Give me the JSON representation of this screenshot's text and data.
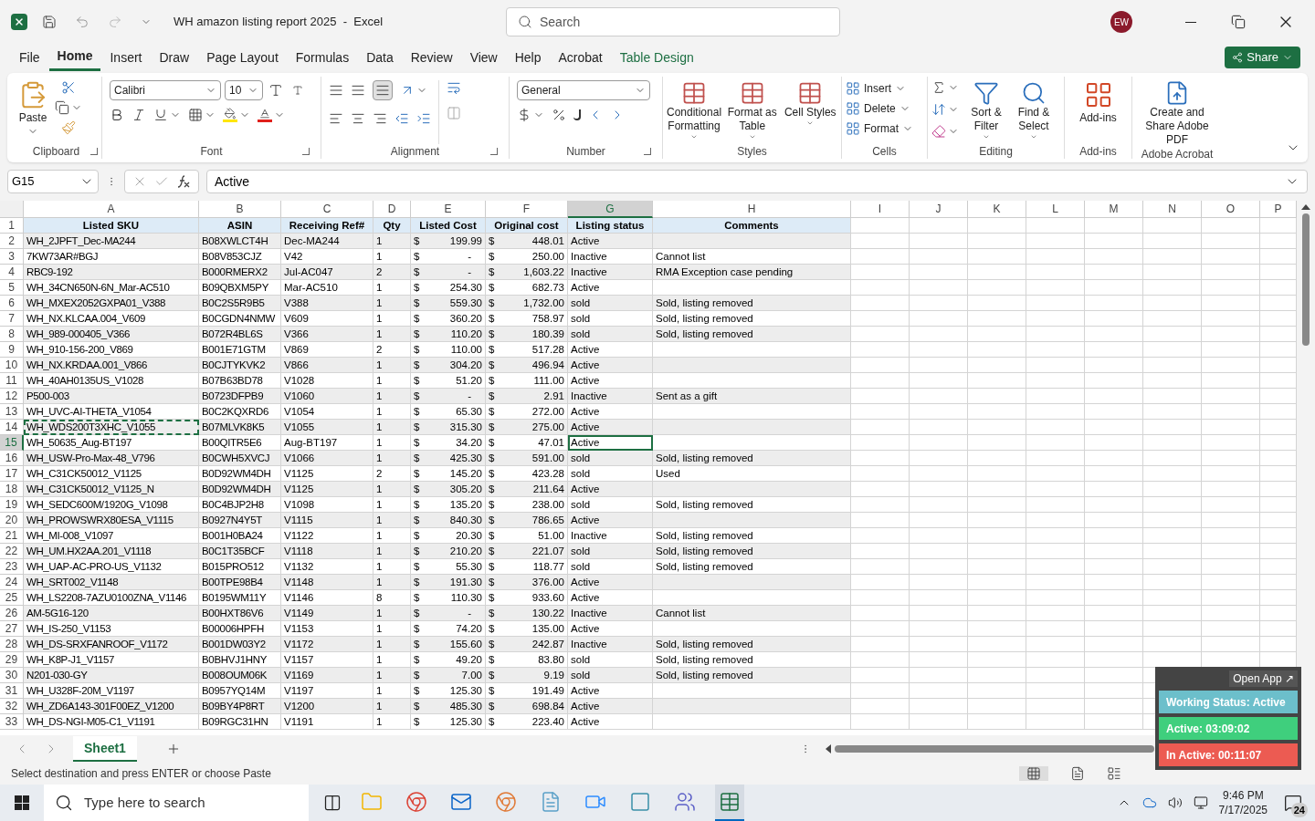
{
  "title_bar": {
    "title": "WH amazon listing report 2025  -  Excel",
    "search_placeholder": "Search",
    "avatar": "EW"
  },
  "menu_tabs": [
    {
      "label": "File",
      "selected": false,
      "kind": "normal"
    },
    {
      "label": "Home",
      "selected": true,
      "kind": "normal"
    },
    {
      "label": "Insert",
      "selected": false,
      "kind": "normal"
    },
    {
      "label": "Draw",
      "selected": false,
      "kind": "normal"
    },
    {
      "label": "Page Layout",
      "selected": false,
      "kind": "normal"
    },
    {
      "label": "Formulas",
      "selected": false,
      "kind": "normal"
    },
    {
      "label": "Data",
      "selected": false,
      "kind": "normal"
    },
    {
      "label": "Review",
      "selected": false,
      "kind": "normal"
    },
    {
      "label": "View",
      "selected": false,
      "kind": "normal"
    },
    {
      "label": "Help",
      "selected": false,
      "kind": "normal"
    },
    {
      "label": "Acrobat",
      "selected": false,
      "kind": "normal"
    },
    {
      "label": "Table Design",
      "selected": false,
      "kind": "contextual"
    }
  ],
  "share_button": "Share",
  "ribbon": {
    "clipboard": {
      "label": "Clipboard",
      "paste": "Paste"
    },
    "font": {
      "label": "Font",
      "name": "Calibri",
      "size": "10"
    },
    "alignment": {
      "label": "Alignment"
    },
    "number": {
      "label": "Number",
      "format": "General"
    },
    "styles": {
      "label": "Styles",
      "items": [
        "Conditional Formatting",
        "Format as Table",
        "Cell Styles"
      ]
    },
    "cells": {
      "label": "Cells",
      "items": [
        "Insert",
        "Delete",
        "Format"
      ]
    },
    "editing": {
      "label": "Editing",
      "items": [
        "Sort & Filter",
        "Find & Select"
      ]
    },
    "addins": {
      "label": "Add-ins",
      "button": "Add-ins"
    },
    "acrobat": {
      "label": "Adobe Acrobat",
      "button": "Create and Share Adobe PDF"
    }
  },
  "formula_bar": {
    "name_box": "G15",
    "value": "Active"
  },
  "column_letters": [
    {
      "letter": "A",
      "selected": false
    },
    {
      "letter": "B",
      "selected": false
    },
    {
      "letter": "C",
      "selected": false
    },
    {
      "letter": "D",
      "selected": false
    },
    {
      "letter": "E",
      "selected": false
    },
    {
      "letter": "F",
      "selected": false
    },
    {
      "letter": "G",
      "selected": true
    },
    {
      "letter": "H",
      "selected": false
    },
    {
      "letter": "I",
      "selected": false
    },
    {
      "letter": "J",
      "selected": false
    },
    {
      "letter": "K",
      "selected": false
    },
    {
      "letter": "L",
      "selected": false
    },
    {
      "letter": "M",
      "selected": false
    },
    {
      "letter": "N",
      "selected": false
    },
    {
      "letter": "O",
      "selected": false
    },
    {
      "letter": "P",
      "selected": false
    }
  ],
  "table": {
    "header_row": "1",
    "columns": [
      "Listed SKU",
      "ASIN",
      "Receiving Ref#",
      "Qty",
      "Listed Cost",
      "Original cost",
      "Listing status",
      "Comments"
    ],
    "rows": [
      {
        "num": "2",
        "sku": "WH_2JPFT_Dec-MA244",
        "asin": "B08XWLCT4H",
        "ref": "Dec-MA244",
        "qty": "1",
        "lc_cur": "$",
        "lc": "199.99",
        "oc_cur": "$",
        "oc": "448.01",
        "status": "Active",
        "selected": false,
        "copied": false
      },
      {
        "num": "3",
        "sku": "7KW73AR#BGJ",
        "asin": "B08V853CJZ",
        "ref": "V42",
        "qty": "1",
        "lc_cur": "$",
        "lc": "-",
        "oc_cur": "$",
        "oc": "250.00",
        "status": "Inactive",
        "comment": "Cannot list",
        "selected": false,
        "copied": false
      },
      {
        "num": "4",
        "sku": "RBC9-192",
        "asin": "B000RMERX2",
        "ref": "Jul-AC047",
        "qty": "2",
        "lc_cur": "$",
        "lc": "-",
        "oc_cur": "$",
        "oc": "1,603.22",
        "status": "Inactive",
        "comment": "RMA Exception case pending",
        "selected": false,
        "copied": false
      },
      {
        "num": "5",
        "sku": "WH_34CN650N-6N_Mar-AC510",
        "asin": "B09QBXM5PY",
        "ref": "Mar-AC510",
        "qty": "1",
        "lc_cur": "$",
        "lc": "254.30",
        "oc_cur": "$",
        "oc": "682.73",
        "status": "Active",
        "selected": false,
        "copied": false
      },
      {
        "num": "6",
        "sku": "WH_MXEX2052GXPA01_V388",
        "asin": "B0C2S5R9B5",
        "ref": "V388",
        "qty": "1",
        "lc_cur": "$",
        "lc": "559.30",
        "oc_cur": "$",
        "oc": "1,732.00",
        "status": "sold",
        "comment": "Sold, listing removed",
        "selected": false,
        "copied": false
      },
      {
        "num": "7",
        "sku": "WH_NX.KLCAA.004_V609",
        "asin": "B0CGDN4NMW",
        "ref": "V609",
        "qty": "1",
        "lc_cur": "$",
        "lc": "360.20",
        "oc_cur": "$",
        "oc": "758.97",
        "status": "sold",
        "comment": "Sold, listing removed",
        "selected": false,
        "copied": false
      },
      {
        "num": "8",
        "sku": "WH_989-000405_V366",
        "asin": "B072R4BL6S",
        "ref": "V366",
        "qty": "1",
        "lc_cur": "$",
        "lc": "110.20",
        "oc_cur": "$",
        "oc": "180.39",
        "status": "sold",
        "comment": "Sold, listing removed",
        "selected": false,
        "copied": false
      },
      {
        "num": "9",
        "sku": "WH_910-156-200_V869",
        "asin": "B001E71GTM",
        "ref": "V869",
        "qty": "2",
        "lc_cur": "$",
        "lc": "110.00",
        "oc_cur": "$",
        "oc": "517.28",
        "status": "Active",
        "selected": false,
        "copied": false
      },
      {
        "num": "10",
        "sku": "WH_NX.KRDAA.001_V866",
        "asin": "B0CJTYKVK2",
        "ref": "V866",
        "qty": "1",
        "lc_cur": "$",
        "lc": "304.20",
        "oc_cur": "$",
        "oc": "496.94",
        "status": "Active",
        "selected": false,
        "copied": false
      },
      {
        "num": "11",
        "sku": "WH_40AH0135US_V1028",
        "asin": "B07B63BD78",
        "ref": "V1028",
        "qty": "1",
        "lc_cur": "$",
        "lc": "51.20",
        "oc_cur": "$",
        "oc": "111.00",
        "status": "Active",
        "selected": false,
        "copied": false
      },
      {
        "num": "12",
        "sku": "P500-003",
        "asin": "B0723DFPB9",
        "ref": "V1060",
        "qty": "1",
        "lc_cur": "$",
        "lc": "-",
        "oc_cur": "$",
        "oc": "2.91",
        "status": "Inactive",
        "comment": "Sent as a gift",
        "selected": false,
        "copied": false
      },
      {
        "num": "13",
        "sku": "WH_UVC-AI-THETA_V1054",
        "asin": "B0C2KQXRD6",
        "ref": "V1054",
        "qty": "1",
        "lc_cur": "$",
        "lc": "65.30",
        "oc_cur": "$",
        "oc": "272.00",
        "status": "Active",
        "selected": false,
        "copied": false
      },
      {
        "num": "14",
        "sku": "WH_WDS200T3XHC_V1055",
        "asin": "B07MLVK8K5",
        "ref": "V1055",
        "qty": "1",
        "lc_cur": "$",
        "lc": "315.30",
        "oc_cur": "$",
        "oc": "275.00",
        "status": "Active",
        "selected": false,
        "copied": true
      },
      {
        "num": "15",
        "sku": "WH_50635_Aug-BT197",
        "asin": "B00QITR5E6",
        "ref": "Aug-BT197",
        "qty": "1",
        "lc_cur": "$",
        "lc": "34.20",
        "oc_cur": "$",
        "oc": "47.01",
        "status": "Active",
        "selected": true,
        "copied": false
      },
      {
        "num": "16",
        "sku": "WH_USW-Pro-Max-48_V796",
        "asin": "B0CWH5XVCJ",
        "ref": "V1066",
        "qty": "1",
        "lc_cur": "$",
        "lc": "425.30",
        "oc_cur": "$",
        "oc": "591.00",
        "status": "sold",
        "comment": "Sold, listing removed",
        "selected": false,
        "copied": false
      },
      {
        "num": "17",
        "sku": "WH_C31CK50012_V1125",
        "asin": "B0D92WM4DH",
        "ref": "V1125",
        "qty": "2",
        "lc_cur": "$",
        "lc": "145.20",
        "oc_cur": "$",
        "oc": "423.28",
        "status": "sold",
        "comment": "Used",
        "selected": false,
        "copied": false
      },
      {
        "num": "18",
        "sku": "WH_C31CK50012_V1125_N",
        "asin": "B0D92WM4DH",
        "ref": "V1125",
        "qty": "1",
        "lc_cur": "$",
        "lc": "305.20",
        "oc_cur": "$",
        "oc": "211.64",
        "status": "Active",
        "selected": false,
        "copied": false
      },
      {
        "num": "19",
        "sku": "WH_SEDC600M/1920G_V1098",
        "asin": "B0C4BJP2H8",
        "ref": "V1098",
        "qty": "1",
        "lc_cur": "$",
        "lc": "135.20",
        "oc_cur": "$",
        "oc": "238.00",
        "status": "sold",
        "comment": "Sold, listing removed",
        "selected": false,
        "copied": false
      },
      {
        "num": "20",
        "sku": "WH_PROWSWRX80ESA_V1115",
        "asin": "B0927N4Y5T",
        "ref": "V1115",
        "qty": "1",
        "lc_cur": "$",
        "lc": "840.30",
        "oc_cur": "$",
        "oc": "786.65",
        "status": "Active",
        "selected": false,
        "copied": false
      },
      {
        "num": "21",
        "sku": "WH_MI-008_V1097",
        "asin": "B001H0BA24",
        "ref": "V1122",
        "qty": "1",
        "lc_cur": "$",
        "lc": "20.30",
        "oc_cur": "$",
        "oc": "51.00",
        "status": "Inactive",
        "comment": "Sold, listing removed",
        "selected": false,
        "copied": false
      },
      {
        "num": "22",
        "sku": "WH_UM.HX2AA.201_V1118",
        "asin": "B0C1T35BCF",
        "ref": "V1118",
        "qty": "1",
        "lc_cur": "$",
        "lc": "210.20",
        "oc_cur": "$",
        "oc": "221.07",
        "status": "sold",
        "comment": "Sold, listing removed",
        "selected": false,
        "copied": false
      },
      {
        "num": "23",
        "sku": "WH_UAP-AC-PRO-US_V1132",
        "asin": "B015PRO512",
        "ref": "V1132",
        "qty": "1",
        "lc_cur": "$",
        "lc": "55.30",
        "oc_cur": "$",
        "oc": "118.77",
        "status": "sold",
        "comment": "Sold, listing removed",
        "selected": false,
        "copied": false
      },
      {
        "num": "24",
        "sku": "WH_SRT002_V1148",
        "asin": "B00TPE98B4",
        "ref": "V1148",
        "qty": "1",
        "lc_cur": "$",
        "lc": "191.30",
        "oc_cur": "$",
        "oc": "376.00",
        "status": "Active",
        "selected": false,
        "copied": false
      },
      {
        "num": "25",
        "sku": "WH_LS2208-7AZU0100ZNA_V1146",
        "asin": "B0195WM11Y",
        "ref": "V1146",
        "qty": "8",
        "lc_cur": "$",
        "lc": "110.30",
        "oc_cur": "$",
        "oc": "933.60",
        "status": "Active",
        "selected": false,
        "copied": false
      },
      {
        "num": "26",
        "sku": "AM-5G16-120",
        "asin": "B00HXT86V6",
        "ref": "V1149",
        "qty": "1",
        "lc_cur": "$",
        "lc": "-",
        "oc_cur": "$",
        "oc": "130.22",
        "status": "Inactive",
        "comment": "Cannot list",
        "selected": false,
        "copied": false
      },
      {
        "num": "27",
        "sku": "WH_IS-250_V1153",
        "asin": "B00006HPFH",
        "ref": "V1153",
        "qty": "1",
        "lc_cur": "$",
        "lc": "74.20",
        "oc_cur": "$",
        "oc": "135.00",
        "status": "Active",
        "selected": false,
        "copied": false
      },
      {
        "num": "28",
        "sku": "WH_DS-SRXFANROOF_V1172",
        "asin": "B001DW03Y2",
        "ref": "V1172",
        "qty": "1",
        "lc_cur": "$",
        "lc": "155.60",
        "oc_cur": "$",
        "oc": "242.87",
        "status": "Inactive",
        "comment": "Sold, listing removed",
        "selected": false,
        "copied": false
      },
      {
        "num": "29",
        "sku": "WH_K8P-J1_V1157",
        "asin": "B0BHVJ1HNY",
        "ref": "V1157",
        "qty": "1",
        "lc_cur": "$",
        "lc": "49.20",
        "oc_cur": "$",
        "oc": "83.80",
        "status": "sold",
        "comment": "Sold, listing removed",
        "selected": false,
        "copied": false
      },
      {
        "num": "30",
        "sku": "N201-030-GY",
        "asin": "B008OUM06K",
        "ref": "V1169",
        "qty": "1",
        "lc_cur": "$",
        "lc": "7.00",
        "oc_cur": "$",
        "oc": "9.19",
        "status": "sold",
        "comment": "Sold, listing removed",
        "selected": false,
        "copied": false
      },
      {
        "num": "31",
        "sku": "WH_U328F-20M_V1197",
        "asin": "B0957YQ14M",
        "ref": "V1197",
        "qty": "1",
        "lc_cur": "$",
        "lc": "125.30",
        "oc_cur": "$",
        "oc": "191.49",
        "status": "Active",
        "selected": false,
        "copied": false
      },
      {
        "num": "32",
        "sku": "WH_ZD6A143-301F00EZ_V1200",
        "asin": "B09BY4P8RT",
        "ref": "V1200",
        "qty": "1",
        "lc_cur": "$",
        "lc": "485.30",
        "oc_cur": "$",
        "oc": "698.84",
        "status": "Active",
        "selected": false,
        "copied": false
      },
      {
        "num": "33",
        "sku": "WH_DS-NGI-M05-C1_V1191",
        "asin": "B09RGC31HN",
        "ref": "V1191",
        "qty": "1",
        "lc_cur": "$",
        "lc": "125.30",
        "oc_cur": "$",
        "oc": "223.40",
        "status": "Active",
        "selected": false,
        "copied": false
      }
    ]
  },
  "sheet_tabs": [
    {
      "label": "Sheet1",
      "selected": true
    }
  ],
  "status_bar": {
    "message": "Select destination and press ENTER or choose Paste"
  },
  "tracker_widget": {
    "open_app": "Open App ↗",
    "items": [
      {
        "label": "Working Status: Active",
        "color": "#6cbfcb"
      },
      {
        "label": "Active: 03:09:02",
        "color": "#3fcf7d"
      },
      {
        "label": "In Active: 00:11:07",
        "color": "#ec5b52"
      }
    ]
  },
  "taskbar": {
    "search_placeholder": "Type here to search",
    "time": "9:46 PM",
    "date": "7/17/2025",
    "notifications": "24"
  }
}
